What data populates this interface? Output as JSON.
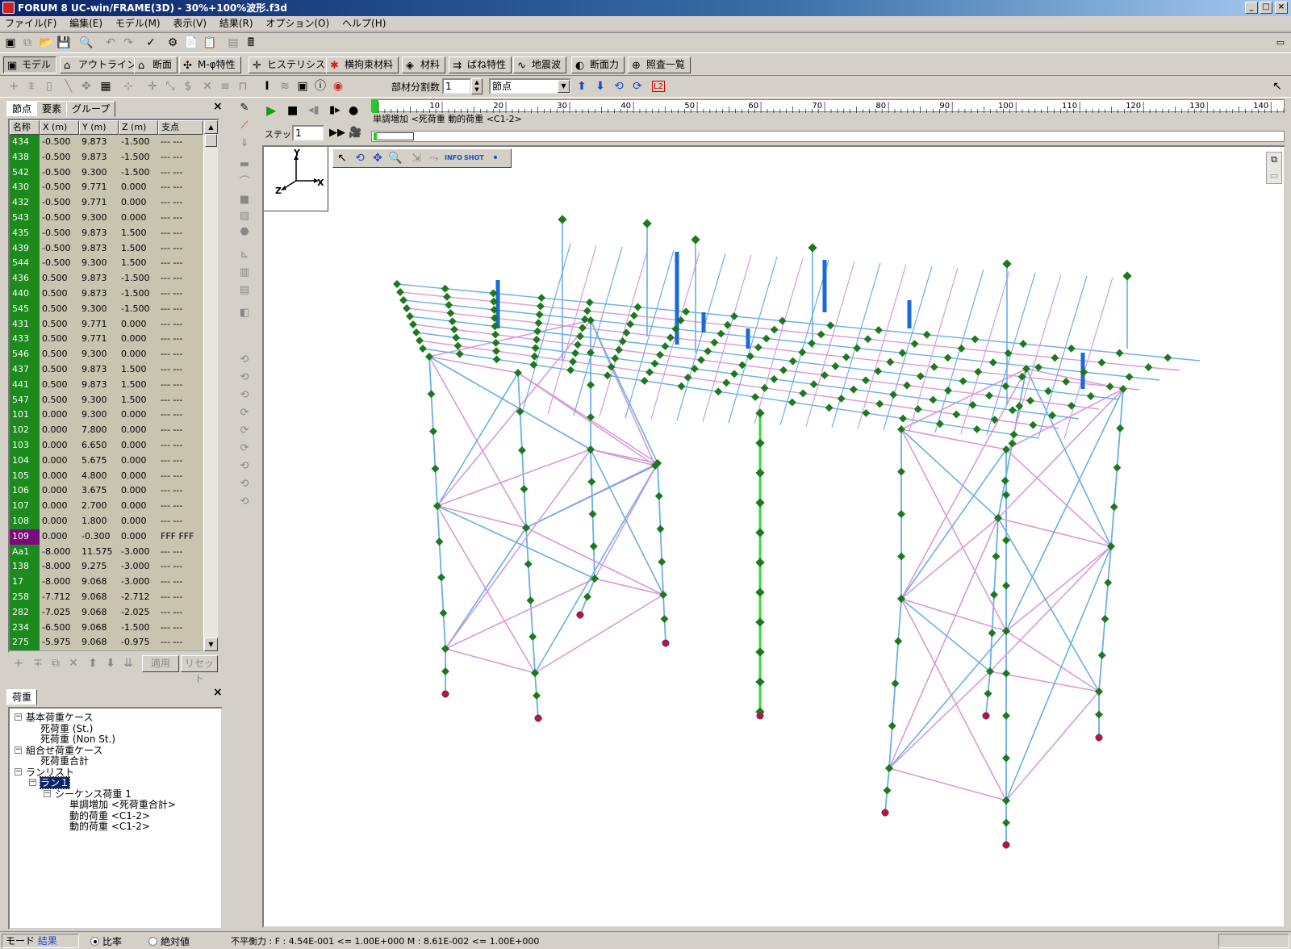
{
  "window": {
    "title": "FORUM 8  UC-win/FRAME(3D) - 30%+100%波形.f3d"
  },
  "menu": [
    "ファイル(F)",
    "編集(E)",
    "モデル(M)",
    "表示(V)",
    "結果(R)",
    "オプション(O)",
    "ヘルプ(H)"
  ],
  "tabs": [
    {
      "label": "モデル",
      "icon": "model-icon"
    },
    {
      "label": "アウトライン",
      "icon": "outline-icon"
    },
    {
      "label": "断面",
      "icon": "section-icon"
    },
    {
      "label": "M-φ特性",
      "icon": "mphi-icon"
    },
    {
      "label": "ヒステリシス",
      "icon": "hysteresis-icon"
    },
    {
      "label": "横拘束材料",
      "icon": "confinement-icon"
    },
    {
      "label": "材料",
      "icon": "material-icon"
    },
    {
      "label": "ばね特性",
      "icon": "spring-icon"
    },
    {
      "label": "地震波",
      "icon": "seismic-wave-icon"
    },
    {
      "label": "断面力",
      "icon": "section-force-icon"
    },
    {
      "label": "照査一覧",
      "icon": "check-list-icon"
    }
  ],
  "toolbar2": {
    "divisions_label": "部材分割数",
    "divisions_value": "1",
    "mode_select": "節点",
    "l2_label": "L2"
  },
  "left_panel": {
    "tabs": [
      "節点",
      "要素",
      "グループ"
    ],
    "columns": [
      "名称",
      "X (m)",
      "Y (m)",
      "Z (m)",
      "支点"
    ],
    "rows": [
      [
        "434",
        "-0.500",
        "9.873",
        "-1.500",
        "--- ---"
      ],
      [
        "438",
        "-0.500",
        "9.873",
        "-1.500",
        "--- ---"
      ],
      [
        "542",
        "-0.500",
        "9.300",
        "-1.500",
        "--- ---"
      ],
      [
        "430",
        "-0.500",
        "9.771",
        "0.000",
        "--- ---"
      ],
      [
        "432",
        "-0.500",
        "9.771",
        "0.000",
        "--- ---"
      ],
      [
        "543",
        "-0.500",
        "9.300",
        "0.000",
        "--- ---"
      ],
      [
        "435",
        "-0.500",
        "9.873",
        "1.500",
        "--- ---"
      ],
      [
        "439",
        "-0.500",
        "9.873",
        "1.500",
        "--- ---"
      ],
      [
        "544",
        "-0.500",
        "9.300",
        "1.500",
        "--- ---"
      ],
      [
        "436",
        "0.500",
        "9.873",
        "-1.500",
        "--- ---"
      ],
      [
        "440",
        "0.500",
        "9.873",
        "-1.500",
        "--- ---"
      ],
      [
        "545",
        "0.500",
        "9.300",
        "-1.500",
        "--- ---"
      ],
      [
        "431",
        "0.500",
        "9.771",
        "0.000",
        "--- ---"
      ],
      [
        "433",
        "0.500",
        "9.771",
        "0.000",
        "--- ---"
      ],
      [
        "546",
        "0.500",
        "9.300",
        "0.000",
        "--- ---"
      ],
      [
        "437",
        "0.500",
        "9.873",
        "1.500",
        "--- ---"
      ],
      [
        "441",
        "0.500",
        "9.873",
        "1.500",
        "--- ---"
      ],
      [
        "547",
        "0.500",
        "9.300",
        "1.500",
        "--- ---"
      ],
      [
        "101",
        "0.000",
        "9.300",
        "0.000",
        "--- ---"
      ],
      [
        "102",
        "0.000",
        "7.800",
        "0.000",
        "--- ---"
      ],
      [
        "103",
        "0.000",
        "6.650",
        "0.000",
        "--- ---"
      ],
      [
        "104",
        "0.000",
        "5.675",
        "0.000",
        "--- ---"
      ],
      [
        "105",
        "0.000",
        "4.800",
        "0.000",
        "--- ---"
      ],
      [
        "106",
        "0.000",
        "3.675",
        "0.000",
        "--- ---"
      ],
      [
        "107",
        "0.000",
        "2.700",
        "0.000",
        "--- ---"
      ],
      [
        "108",
        "0.000",
        "1.800",
        "0.000",
        "--- ---"
      ],
      [
        "109",
        "0.000",
        "-0.300",
        "0.000",
        "FFF FFF"
      ],
      [
        "Aa1",
        "-8.000",
        "11.575",
        "-3.000",
        "--- ---"
      ],
      [
        "138",
        "-8.000",
        "9.275",
        "-3.000",
        "--- ---"
      ],
      [
        "17",
        "-8.000",
        "9.068",
        "-3.000",
        "--- ---"
      ],
      [
        "258",
        "-7.712",
        "9.068",
        "-2.712",
        "--- ---"
      ],
      [
        "282",
        "-7.025",
        "9.068",
        "-2.025",
        "--- ---"
      ],
      [
        "234",
        "-6.500",
        "9.068",
        "-1.500",
        "--- ---"
      ],
      [
        "275",
        "-5.975",
        "9.068",
        "-0.975",
        "--- ---"
      ]
    ],
    "apply_label": "適用",
    "reset_label": "リセット"
  },
  "load_panel": {
    "tab": "荷重",
    "tree": [
      {
        "label": "基本荷重ケース",
        "level": 0,
        "toggle": "−"
      },
      {
        "label": "死荷重 (St.)",
        "level": 1
      },
      {
        "label": "死荷重 (Non St.)",
        "level": 1
      },
      {
        "label": "組合せ荷重ケース",
        "level": 0,
        "toggle": "−"
      },
      {
        "label": "死荷重合計",
        "level": 1
      },
      {
        "label": "ランリスト",
        "level": 0,
        "toggle": "−"
      },
      {
        "label": "ラン１",
        "level": 1,
        "toggle": "−",
        "selected": true
      },
      {
        "label": "シーケンス荷重 1",
        "level": 2,
        "toggle": "−"
      },
      {
        "label": "単調増加 <死荷重合計>",
        "level": 3
      },
      {
        "label": "動的荷重 <C1-2>",
        "level": 3
      },
      {
        "label": "動的荷重 <C1-2>",
        "level": 3
      }
    ]
  },
  "playback": {
    "step_label": "ステップ",
    "step_value": "1",
    "sequence_label": "単調増加 <死荷重 動的荷重 <C1-2>",
    "ruler_ticks": [
      "10",
      "20",
      "30",
      "40",
      "50",
      "60",
      "70",
      "80",
      "90",
      "100",
      "110",
      "120",
      "130",
      "140"
    ]
  },
  "axes": {
    "x": "X",
    "y": "Y",
    "z": "Z"
  },
  "viewport_tools": [
    "pointer-icon",
    "rotate-icon",
    "pan-icon",
    "zoom-icon",
    "move-icon",
    "select-icon",
    "info-icon",
    "shot-icon",
    "dot-icon"
  ],
  "viewport_labels": {
    "info": "INFO",
    "shot": "SHOT"
  },
  "statusbar": {
    "mode_label": "モード",
    "mode_value": "結果",
    "radio_ratio": "比率",
    "radio_absolute": "絶対値",
    "message": "不平衡力 : F : 4.54E-001 <= 1.00E+000 M : 8.61E-002 <= 1.00E+000"
  },
  "colors": {
    "node": "#1c7a1c",
    "member_blue": "#6aaee8",
    "member_pink": "#d89ad8",
    "support": "#cc1020",
    "selected_column": "#33dd33"
  }
}
